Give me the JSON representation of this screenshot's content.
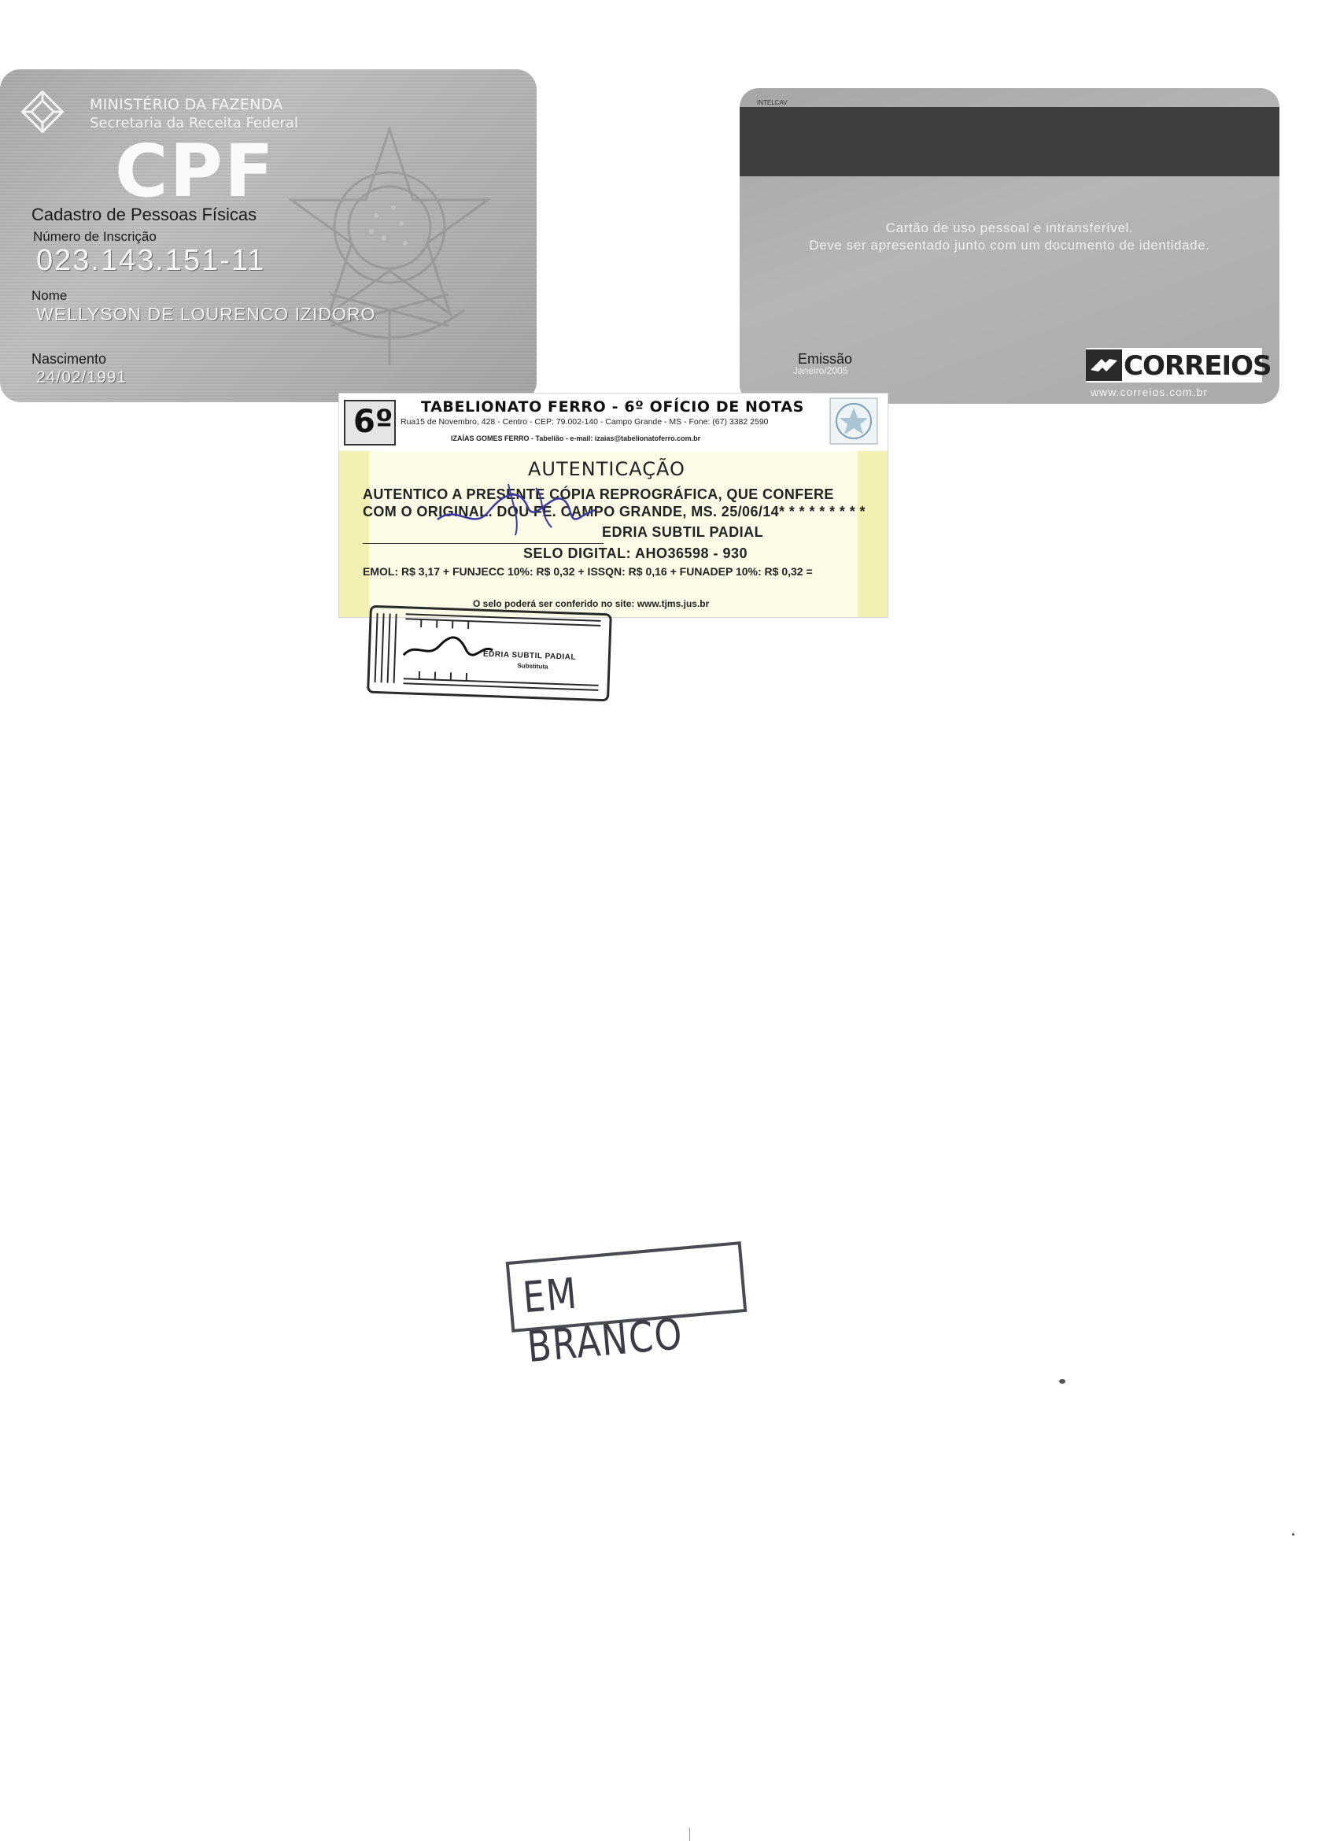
{
  "cpf_front": {
    "ministry": "MINISTÉRIO DA FAZENDA",
    "secretaria": "Secretaria da Receita Federal",
    "title": "CPF",
    "subtitle": "Cadastro de Pessoas Físicas",
    "number_label": "Número de Inscrição",
    "number_value": "023.143.151-11",
    "name_label": "Nome",
    "name_value": "WELLYSON DE LOURENCO IZIDORO",
    "birth_label": "Nascimento",
    "birth_value": "24/02/1991",
    "logo_icon": "ministerio-fazenda-logo",
    "emblem_icon": "brazil-coat-of-arms"
  },
  "cpf_back": {
    "line1": "Cartão de uso pessoal e intransferível.",
    "line2": "Deve ser apresentado junto com um documento de identidade.",
    "issue_label": "Emissão",
    "issue_value": "Janeiro/2005",
    "brand": "CORREIOS",
    "url": "www.correios.com.br",
    "printer": "INTELCAV",
    "logo_icon": "correios-logo"
  },
  "notary": {
    "number": "6º",
    "title": "TABELIONATO FERRO - 6º OFÍCIO DE NOTAS",
    "address": "Rua15 de Novembro, 428 - Centro - CEP: 79.002-140 - Campo Grande - MS - Fone: (67) 3382 2590",
    "email_line": "IZAÍAS GOMES FERRO - Tabelião - e-mail: izaias@tabelionatoferro.com.br",
    "heading": "AUTENTICAÇÃO",
    "text_line1": "AUTENTICO A PRESENTE CÓPIA REPROGRÁFICA, QUE CONFERE",
    "text_line2": "COM O ORIGINAL. DOU FÉ. CAMPO GRANDE, MS. 25/06/14* * * * * * * * *",
    "tabeliao": "EDRIA SUBTIL PADIAL",
    "seal": "SELO DIGITAL: AHO36598 - 930",
    "fees": "EMOL: R$ 3,17 + FUNJECC 10%: R$ 0,32 + ISSQN: R$ 0,16 + FUNADEP 10%: R$ 0,32 =",
    "site": "O selo poderá ser conferido no site: www.tjms.jus.br",
    "seal_icon": "tjms-hologram-seal",
    "signature_icon": "handwritten-signature"
  },
  "substitute_stamp": {
    "name": "EDRIA SUBTIL PADIAL",
    "role": "Substituta",
    "signature_icon": "handwritten-signature"
  },
  "blank_stamp": {
    "text": "EM BRANCO"
  },
  "colors": {
    "card_gray": "#b0b0b0",
    "mag_stripe": "#3e3e3e",
    "label_yellow": "#f3f0b3",
    "signature_blue": "#3a3aa0",
    "stamp_ink": "#3c3c46"
  }
}
